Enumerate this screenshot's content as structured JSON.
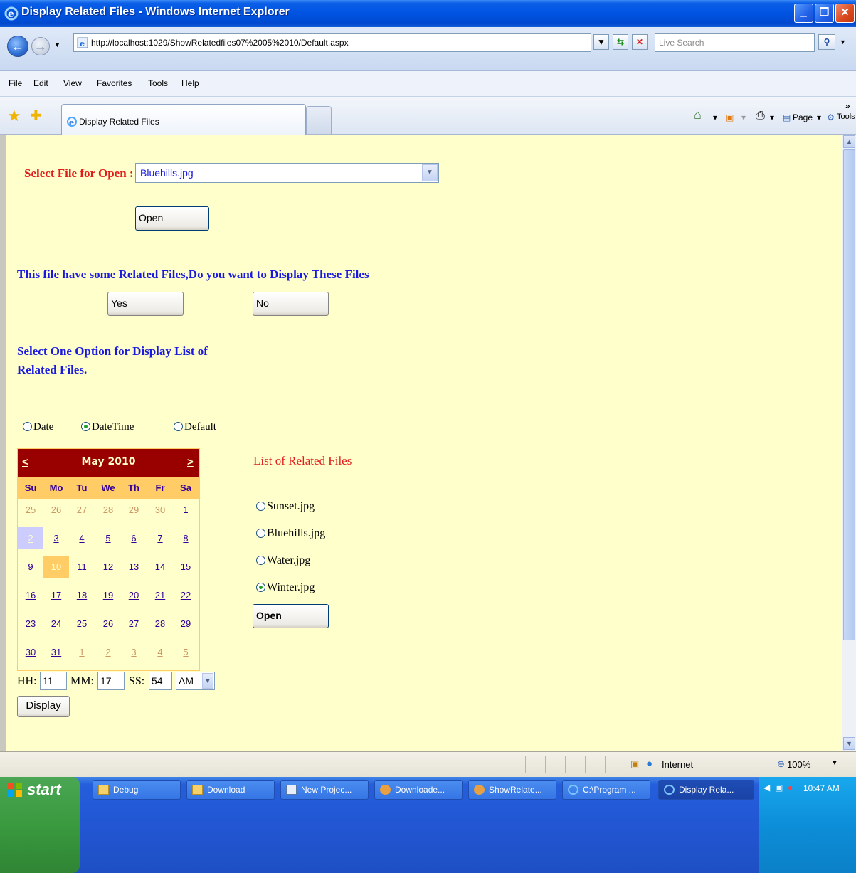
{
  "window": {
    "title": "Display Related Files - Windows Internet Explorer"
  },
  "address_bar": {
    "url": "http://localhost:1029/ShowRelatedfiles07%2005%2010/Default.aspx",
    "search_placeholder": "Live Search"
  },
  "menu": [
    "File",
    "Edit",
    "View",
    "Favorites",
    "Tools",
    "Help"
  ],
  "tab": {
    "title": "Display Related Files"
  },
  "command_bar": {
    "page_label": "Page",
    "tools_label": "Tools"
  },
  "page": {
    "select_label": "Select File for Open :",
    "select_value": "Bluehills.jpg",
    "open_button": "Open",
    "related_prompt": "This file have some Related Files,Do you want to Display These Files",
    "yes_button": "Yes",
    "no_button": "No",
    "option_heading_line1": "Select One Option for Display List of",
    "option_heading_line2": "Related Files.",
    "radio_options": [
      {
        "label": "Date",
        "checked": false
      },
      {
        "label": "DateTime",
        "checked": true
      },
      {
        "label": "Default",
        "checked": false
      }
    ],
    "calendar": {
      "prev": "<",
      "next": ">",
      "month_title": "May 2010",
      "days_of_week": [
        "Su",
        "Mo",
        "Tu",
        "We",
        "Th",
        "Fr",
        "Sa"
      ],
      "weeks": [
        [
          "25",
          "26",
          "27",
          "28",
          "29",
          "30",
          "1"
        ],
        [
          "2",
          "3",
          "4",
          "5",
          "6",
          "7",
          "8"
        ],
        [
          "9",
          "10",
          "11",
          "12",
          "13",
          "14",
          "15"
        ],
        [
          "16",
          "17",
          "18",
          "19",
          "20",
          "21",
          "22"
        ],
        [
          "23",
          "24",
          "25",
          "26",
          "27",
          "28",
          "29"
        ],
        [
          "30",
          "31",
          "1",
          "2",
          "3",
          "4",
          "5"
        ]
      ],
      "selected_day": "2",
      "today_day": "10"
    },
    "time": {
      "hh_label": "HH:",
      "hh_value": "11",
      "mm_label": "MM:",
      "mm_value": "17",
      "ss_label": "SS:",
      "ss_value": "54",
      "ampm_value": "AM"
    },
    "display_button": "Display",
    "related_list_title": "List of Related Files",
    "related_files": [
      {
        "label": "Sunset.jpg",
        "checked": false
      },
      {
        "label": "Bluehills.jpg",
        "checked": false
      },
      {
        "label": "Water.jpg",
        "checked": false
      },
      {
        "label": "Winter.jpg",
        "checked": true
      }
    ],
    "related_open_button": "Open"
  },
  "status_bar": {
    "zone": "Internet",
    "zoom": "100%"
  },
  "taskbar": {
    "start_label": "start",
    "items": [
      {
        "label": "Debug",
        "icon": "folder-icon"
      },
      {
        "label": "Download",
        "icon": "folder-icon"
      },
      {
        "label": "New Projec...",
        "icon": "document-icon"
      },
      {
        "label": "Downloade...",
        "icon": "app-icon"
      },
      {
        "label": "ShowRelate...",
        "icon": "app-icon"
      },
      {
        "label": "C:\\Program ...",
        "icon": "ie-icon"
      },
      {
        "label": "Display Rela...",
        "icon": "ie-icon"
      }
    ],
    "clock": "10:47 AM"
  },
  "colors": {
    "page_background": "#ffffcc",
    "label_red": "#e21b1b",
    "label_blue": "#1a1adf",
    "calendar_header": "#990000",
    "calendar_dow": "#ffcc66"
  }
}
